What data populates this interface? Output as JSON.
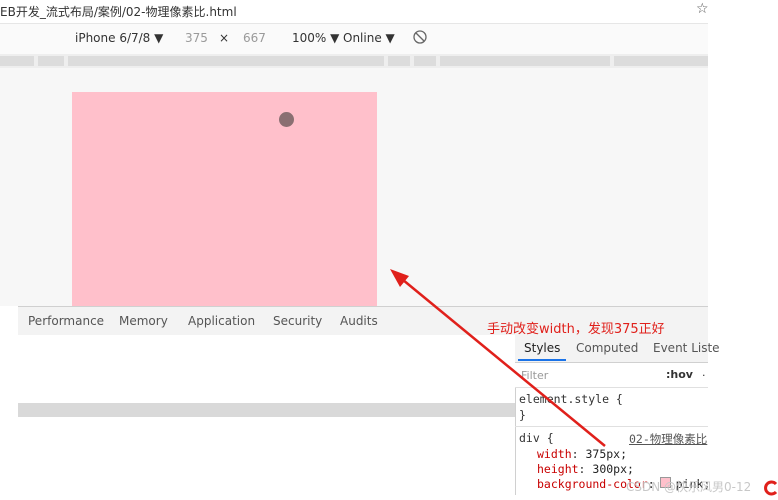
{
  "titlebar": {
    "url_text": "EB开发_流式布局/案例/02-物理像素比.html",
    "star_icon": "star-icon"
  },
  "device_toolbar": {
    "device": "iPhone 6/7/8 ▼",
    "width": "375",
    "times": "×",
    "height": "667",
    "zoom": "100% ▼",
    "network": "Online ▼",
    "rotate_icon": "rotate-icon"
  },
  "devtools": {
    "tabs": [
      "Performance",
      "Memory",
      "Application",
      "Security",
      "Audits"
    ]
  },
  "styles_pane": {
    "tabs": [
      "Styles",
      "Computed",
      "Event Liste"
    ],
    "filter_placeholder": "Filter",
    "hov": ":hov",
    "hov_more": ".",
    "element_style_open": "element.style {",
    "element_style_close": "}",
    "rule_selector": "div {",
    "rule_source": "02-物理像素比",
    "decls": [
      {
        "prop": "width",
        "colon": ": ",
        "value": "375px;"
      },
      {
        "prop": "height",
        "colon": ": ",
        "value": "300px;"
      },
      {
        "prop": "background-color",
        "colon": ": ",
        "value": "pink;"
      }
    ]
  },
  "annotation": {
    "text": "手动改变width，发现375正好",
    "color": "#e0201b"
  },
  "watermark": {
    "text": "CSDN @快乐风男0-12"
  },
  "colors": {
    "pink": "#ffc0cb",
    "accent": "#1a73e8",
    "annotation_red": "#e0201b"
  }
}
